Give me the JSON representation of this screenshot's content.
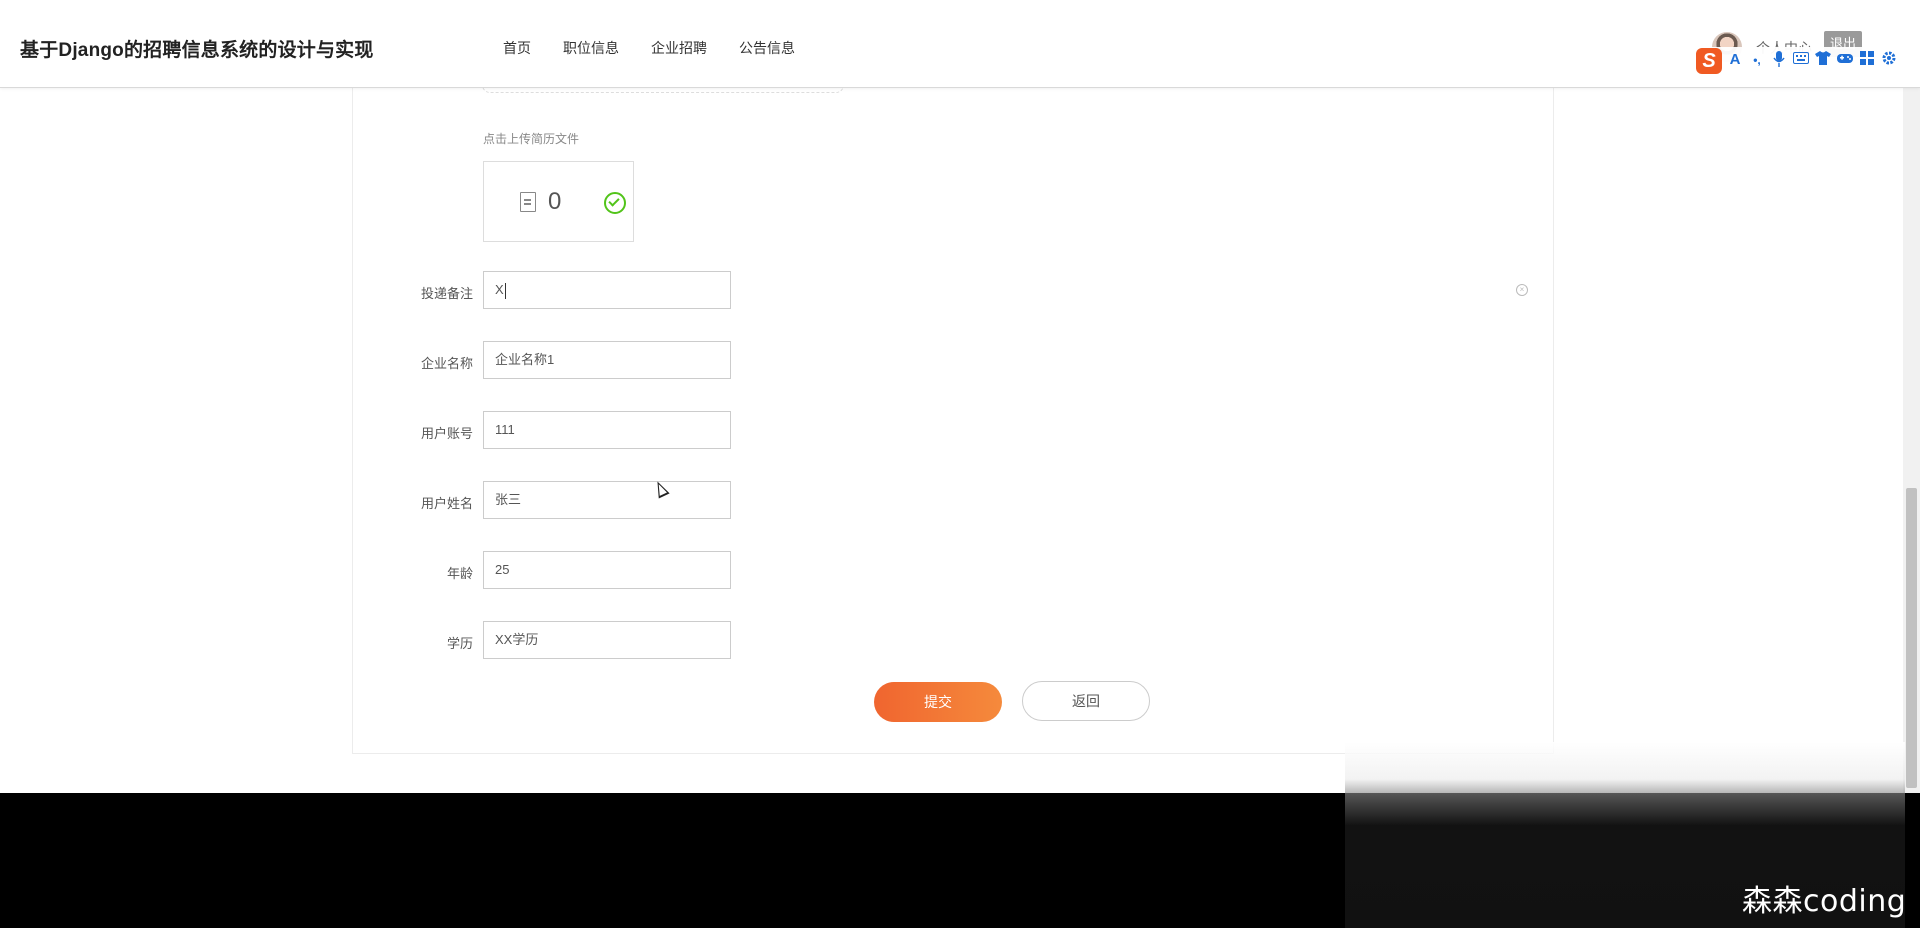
{
  "header": {
    "title": "基于Django的招聘信息系统的设计与实现",
    "nav": [
      {
        "label": "首页"
      },
      {
        "label": "职位信息"
      },
      {
        "label": "企业招聘"
      },
      {
        "label": "公告信息"
      }
    ],
    "user_center": "个人中心",
    "logout": "退出"
  },
  "ime": {
    "logo": "S",
    "icons": [
      "A",
      "•,",
      "mic",
      "keyboard",
      "shirt",
      "gamepad",
      "grid",
      "gear"
    ]
  },
  "form": {
    "upload_hint": "点击上传简历文件",
    "file_count": "0",
    "rows": [
      {
        "label": "投递备注",
        "value": "X"
      },
      {
        "label": "企业名称",
        "value": "企业名称1"
      },
      {
        "label": "用户账号",
        "value": "111"
      },
      {
        "label": "用户姓名",
        "value": "张三"
      },
      {
        "label": "年龄",
        "value": "25"
      },
      {
        "label": "学历",
        "value": "XX学历"
      }
    ],
    "submit": "提交",
    "back": "返回"
  },
  "watermark": "森森coding",
  "colors": {
    "accent": "#f0652f",
    "success": "#52c41a",
    "ime_blue": "#1f6fd6"
  }
}
